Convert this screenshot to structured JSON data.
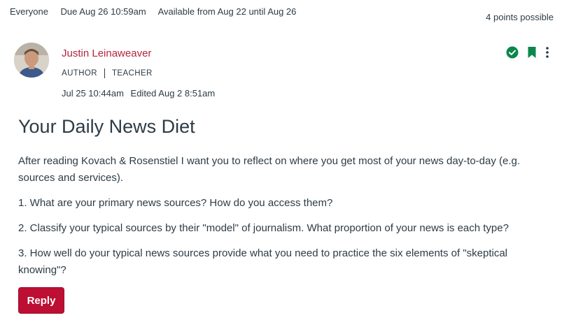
{
  "assignment": {
    "audience": "Everyone",
    "due": "Due Aug 26 10:59am",
    "availability": "Available from Aug 22 until Aug 26",
    "points": "4 points possible"
  },
  "post": {
    "author_name": "Justin Leinaweaver",
    "roles": [
      "AUTHOR",
      "TEACHER"
    ],
    "posted": "Jul 25 10:44am",
    "edited": "Edited Aug 2 8:51am",
    "title": "Your Daily News Diet",
    "paragraphs": [
      "After reading Kovach & Rosenstiel I want you to reflect on where you get most of your news day-to-day (e.g. sources and services).",
      "1. What are your primary news sources? How do you access them?",
      "2. Classify your typical sources by their \"model\" of journalism. What proportion of your news is each type?",
      "3. How well do your typical news sources provide what you need to practice the six elements of \"skeptical knowing\"?"
    ],
    "reply_label": "Reply"
  },
  "icons": {
    "published": "check-circle-icon",
    "bookmark": "bookmark-icon",
    "menu": "more-vertical-icon"
  },
  "colors": {
    "author_link": "#b2253f",
    "reply_button": "#bd0f33",
    "success": "#0b874b",
    "text": "#2d3b45"
  }
}
